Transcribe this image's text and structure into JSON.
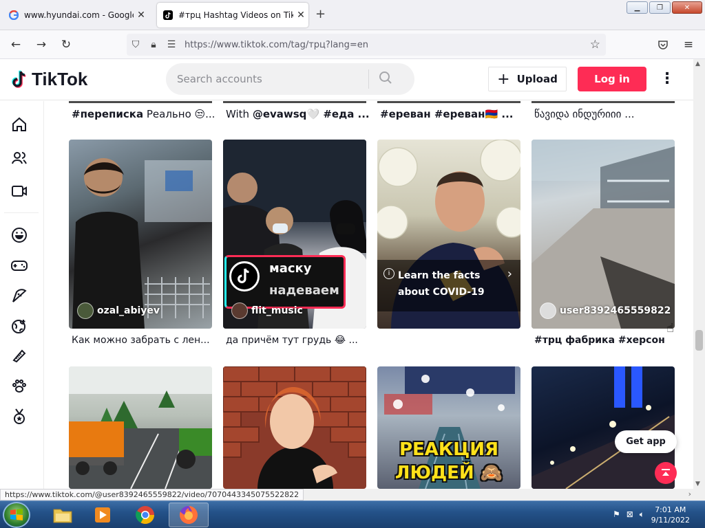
{
  "browser": {
    "tabs": [
      {
        "title": "www.hyundai.com - Google Sea",
        "favicon": "google-icon",
        "active": false
      },
      {
        "title": "#трц Hashtag Videos on TikTok",
        "favicon": "tiktok-icon",
        "active": true
      }
    ],
    "url": "https://www.tiktok.com/tag/трц?lang=en",
    "status_url": "https://www.tiktok.com/@user8392465559822/video/7070443345075522822"
  },
  "tiktok": {
    "logo_text": "TikTok",
    "search_placeholder": "Search accounts",
    "upload_label": "Upload",
    "login_label": "Log in",
    "accent_color": "#fe2c55",
    "top_row_captions": [
      {
        "pre": "#переписка",
        "rest": " Реально 😒..."
      },
      {
        "pre": "With ",
        "bold": "@evawsq",
        "rest": "🤍 #еда ..."
      },
      {
        "pre": "#ереван #ереван",
        "rest": "🇦🇲 ..."
      },
      {
        "pre": "",
        "rest": "წავიდა ინდურიიი ..."
      }
    ],
    "videos": [
      {
        "user": "ozal_abiyev",
        "caption": "Как можно забрать с лен..."
      },
      {
        "user": "flit_music",
        "caption": "да причём тут грудь 😂 ...",
        "overlay_text_1": "маску",
        "overlay_text_2": "надеваем"
      },
      {
        "covid_banner": "Learn the facts about COVID-19",
        "caption": ""
      },
      {
        "user": "user8392465559822",
        "caption": "#трц фабрика #херсон"
      }
    ],
    "bottom_videos": [
      {
        "overlay": ""
      },
      {
        "overlay": ""
      },
      {
        "overlay_line_1": "РЕАКЦИЯ",
        "overlay_line_2": "ЛЮДЕЙ 🙈"
      },
      {
        "get_app": "Get app"
      }
    ]
  },
  "taskbar": {
    "time": "7:01 AM",
    "date": "9/11/2022"
  }
}
